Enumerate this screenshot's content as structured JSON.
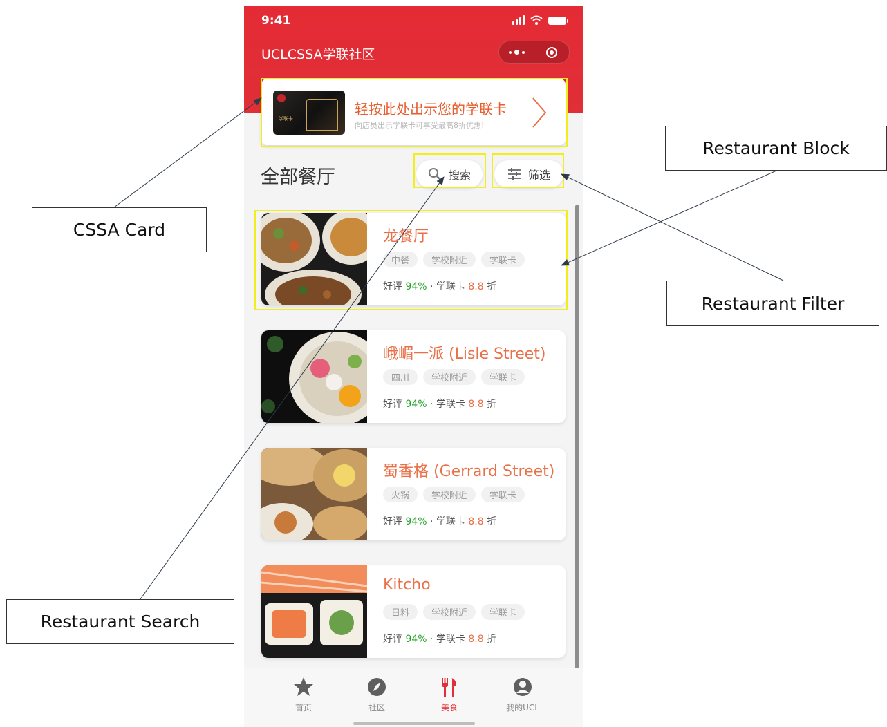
{
  "status_bar": {
    "time": "9:41"
  },
  "header": {
    "app_title": "UCLCSSA学联社区"
  },
  "card_banner": {
    "title": "轻按此处出示您的学联卡",
    "subtitle": "向店员出示学联卡可享受最高8折优惠!"
  },
  "section": {
    "title": "全部餐厅",
    "search_label": "搜索",
    "filter_label": "筛选"
  },
  "restaurants": [
    {
      "name": "龙餐厅",
      "tags": [
        "中餐",
        "学校附近",
        "学联卡"
      ],
      "rating_label": "好评",
      "rating": "94%",
      "card_label": "学联卡",
      "discount": "8.8",
      "discount_unit": "折"
    },
    {
      "name": "峨嵋一派 (Lisle Street)",
      "tags": [
        "四川",
        "学校附近",
        "学联卡"
      ],
      "rating_label": "好评",
      "rating": "94%",
      "card_label": "学联卡",
      "discount": "8.8",
      "discount_unit": "折"
    },
    {
      "name": "蜀香格 (Gerrard Street)",
      "tags": [
        "火锅",
        "学校附近",
        "学联卡"
      ],
      "rating_label": "好评",
      "rating": "94%",
      "card_label": "学联卡",
      "discount": "8.8",
      "discount_unit": "折"
    },
    {
      "name": "Kitcho",
      "tags": [
        "日料",
        "学校附近",
        "学联卡"
      ],
      "rating_label": "好评",
      "rating": "94%",
      "card_label": "学联卡",
      "discount": "8.8",
      "discount_unit": "折"
    }
  ],
  "tabbar": {
    "tabs": [
      {
        "label": "首页",
        "icon": "star-icon"
      },
      {
        "label": "社区",
        "icon": "compass-icon"
      },
      {
        "label": "美食",
        "icon": "fork-knife-icon",
        "active": true
      },
      {
        "label": "我的UCL",
        "icon": "user-icon"
      }
    ]
  },
  "annotations": {
    "cssa_card": "CSSA Card",
    "restaurant_block": "Restaurant Block",
    "restaurant_filter": "Restaurant Filter",
    "restaurant_search": "Restaurant Search"
  },
  "colors": {
    "brand_red": "#e02f36",
    "accent_orange": "#e9714a",
    "rating_green": "#27a42b",
    "highlight_yellow": "#f2ee1c"
  }
}
